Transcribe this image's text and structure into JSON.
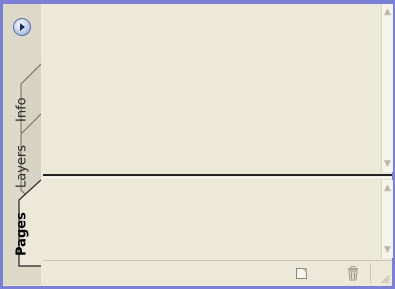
{
  "panel": {
    "menu_button_icon": "panel-menu-arrow",
    "tabs": [
      {
        "label": "Info",
        "active": false
      },
      {
        "label": "Layers",
        "active": false
      },
      {
        "label": "Pages",
        "active": true
      }
    ]
  },
  "toolbar": {
    "new_icon": "new-page-icon",
    "delete_icon": "trash-icon"
  },
  "colors": {
    "frame": "#7b7fd6",
    "panel_bg": "#ece9d8",
    "tab_bg": "#dcd9c9"
  }
}
